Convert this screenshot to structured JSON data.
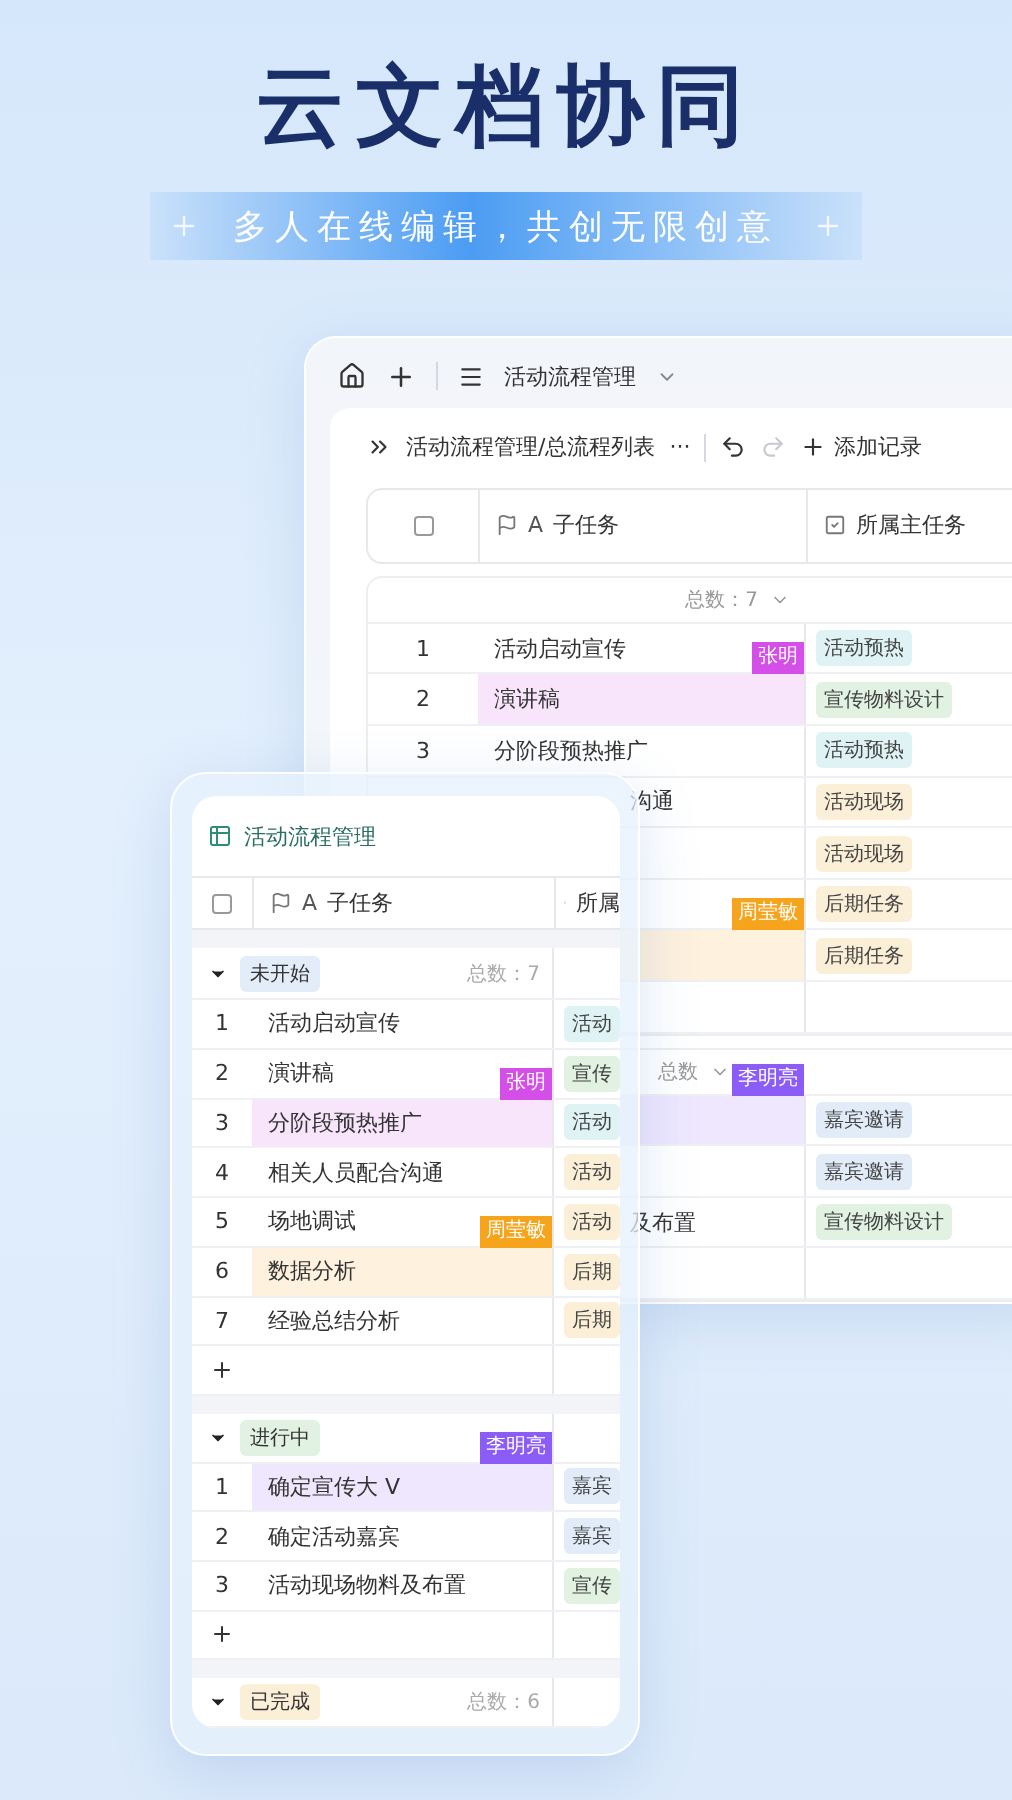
{
  "headline": "云文档协同",
  "tagline": "多人在线编辑，共创无限创意",
  "desktop_window": {
    "app_title": "活动流程管理",
    "breadcrumb": "活动流程管理/总流程列表",
    "more": "···",
    "add_record": "添加记录",
    "select_all": {
      "checked": false
    },
    "columns": [
      {
        "type_mark": "A",
        "label": "子任务"
      },
      {
        "label": "所属主任务"
      }
    ],
    "groups": [
      {
        "total": "总数：7",
        "rows": [
          {
            "number": "1",
            "task": "活动启动宣传",
            "parent": {
              "label": "活动预热",
              "color": "#dff3f5"
            }
          },
          {
            "number": "2",
            "task": "演讲稿",
            "parent": {
              "label": "宣传物料设计",
              "color": "#e2f2e2"
            },
            "collaborator": {
              "name": "张明",
              "color": "#d34fe8"
            }
          },
          {
            "number": "3",
            "task": "分阶段预热推广",
            "parent": {
              "label": "活动预热",
              "color": "#dff3f5"
            }
          },
          {
            "task": "沟通",
            "parent": {
              "label": "活动现场",
              "color": "#fcefd8"
            }
          },
          {
            "parent": {
              "label": "活动现场",
              "color": "#fcefd8"
            }
          },
          {
            "parent": {
              "label": "后期任务",
              "color": "#fcefd8"
            }
          },
          {
            "parent": {
              "label": "后期任务",
              "color": "#fcefd8"
            },
            "collaborator": {
              "name": "周莹敏",
              "color": "#f5a41c"
            }
          },
          {}
        ]
      },
      {
        "total": "总数",
        "rows": [
          {
            "parent": {
              "label": "嘉宾邀请",
              "color": "#e1ecf8"
            },
            "collaborator": {
              "name": "李明亮",
              "color": "#8b5cf6"
            }
          },
          {
            "parent": {
              "label": "嘉宾邀请",
              "color": "#e1ecf8"
            }
          },
          {
            "task": "及布置",
            "parent": {
              "label": "宣传物料设计",
              "color": "#e2f2e2"
            }
          },
          {}
        ]
      }
    ]
  },
  "mobile_card": {
    "title": "活动流程管理",
    "select_all": {
      "checked": false
    },
    "columns": [
      {
        "type_mark": "A",
        "label": "子任务"
      },
      {
        "label": "所属"
      }
    ],
    "groups": [
      {
        "label": "未开始",
        "color": "#e3edf9",
        "total": "总数：7",
        "rows": [
          {
            "number": "1",
            "task": "活动启动宣传",
            "parent": {
              "label": "活动",
              "color": "#dff3f5"
            }
          },
          {
            "number": "2",
            "task": "演讲稿",
            "parent": {
              "label": "宣传",
              "color": "#e2f2e2"
            }
          },
          {
            "number": "3",
            "task": "分阶段预热推广",
            "parent": {
              "label": "活动",
              "color": "#dff3f5"
            },
            "collaborator": {
              "name": "张明",
              "color": "#d34fe8"
            }
          },
          {
            "number": "4",
            "task": "相关人员配合沟通",
            "parent": {
              "label": "活动",
              "color": "#fcefd8"
            }
          },
          {
            "number": "5",
            "task": "场地调试",
            "parent": {
              "label": "活动",
              "color": "#fcefd8"
            }
          },
          {
            "number": "6",
            "task": "数据分析",
            "parent": {
              "label": "后期",
              "color": "#fcefd8"
            },
            "collaborator": {
              "name": "周莹敏",
              "color": "#f5a41c"
            }
          },
          {
            "number": "7",
            "task": "经验总结分析",
            "parent": {
              "label": "后期",
              "color": "#fcefd8"
            }
          }
        ]
      },
      {
        "label": "进行中",
        "color": "#e2f2e2",
        "rows": [
          {
            "number": "1",
            "task": "确定宣传大 V",
            "parent": {
              "label": "嘉宾",
              "color": "#e1ecf8"
            },
            "collaborator": {
              "name": "李明亮",
              "color": "#8b5cf6"
            }
          },
          {
            "number": "2",
            "task": "确定活动嘉宾",
            "parent": {
              "label": "嘉宾",
              "color": "#e1ecf8"
            }
          },
          {
            "number": "3",
            "task": "活动现场物料及布置",
            "parent": {
              "label": "宣传",
              "color": "#e2f2e2"
            }
          }
        ]
      },
      {
        "label": "已完成",
        "color": "#fcefd8",
        "total": "总数：6"
      }
    ]
  }
}
